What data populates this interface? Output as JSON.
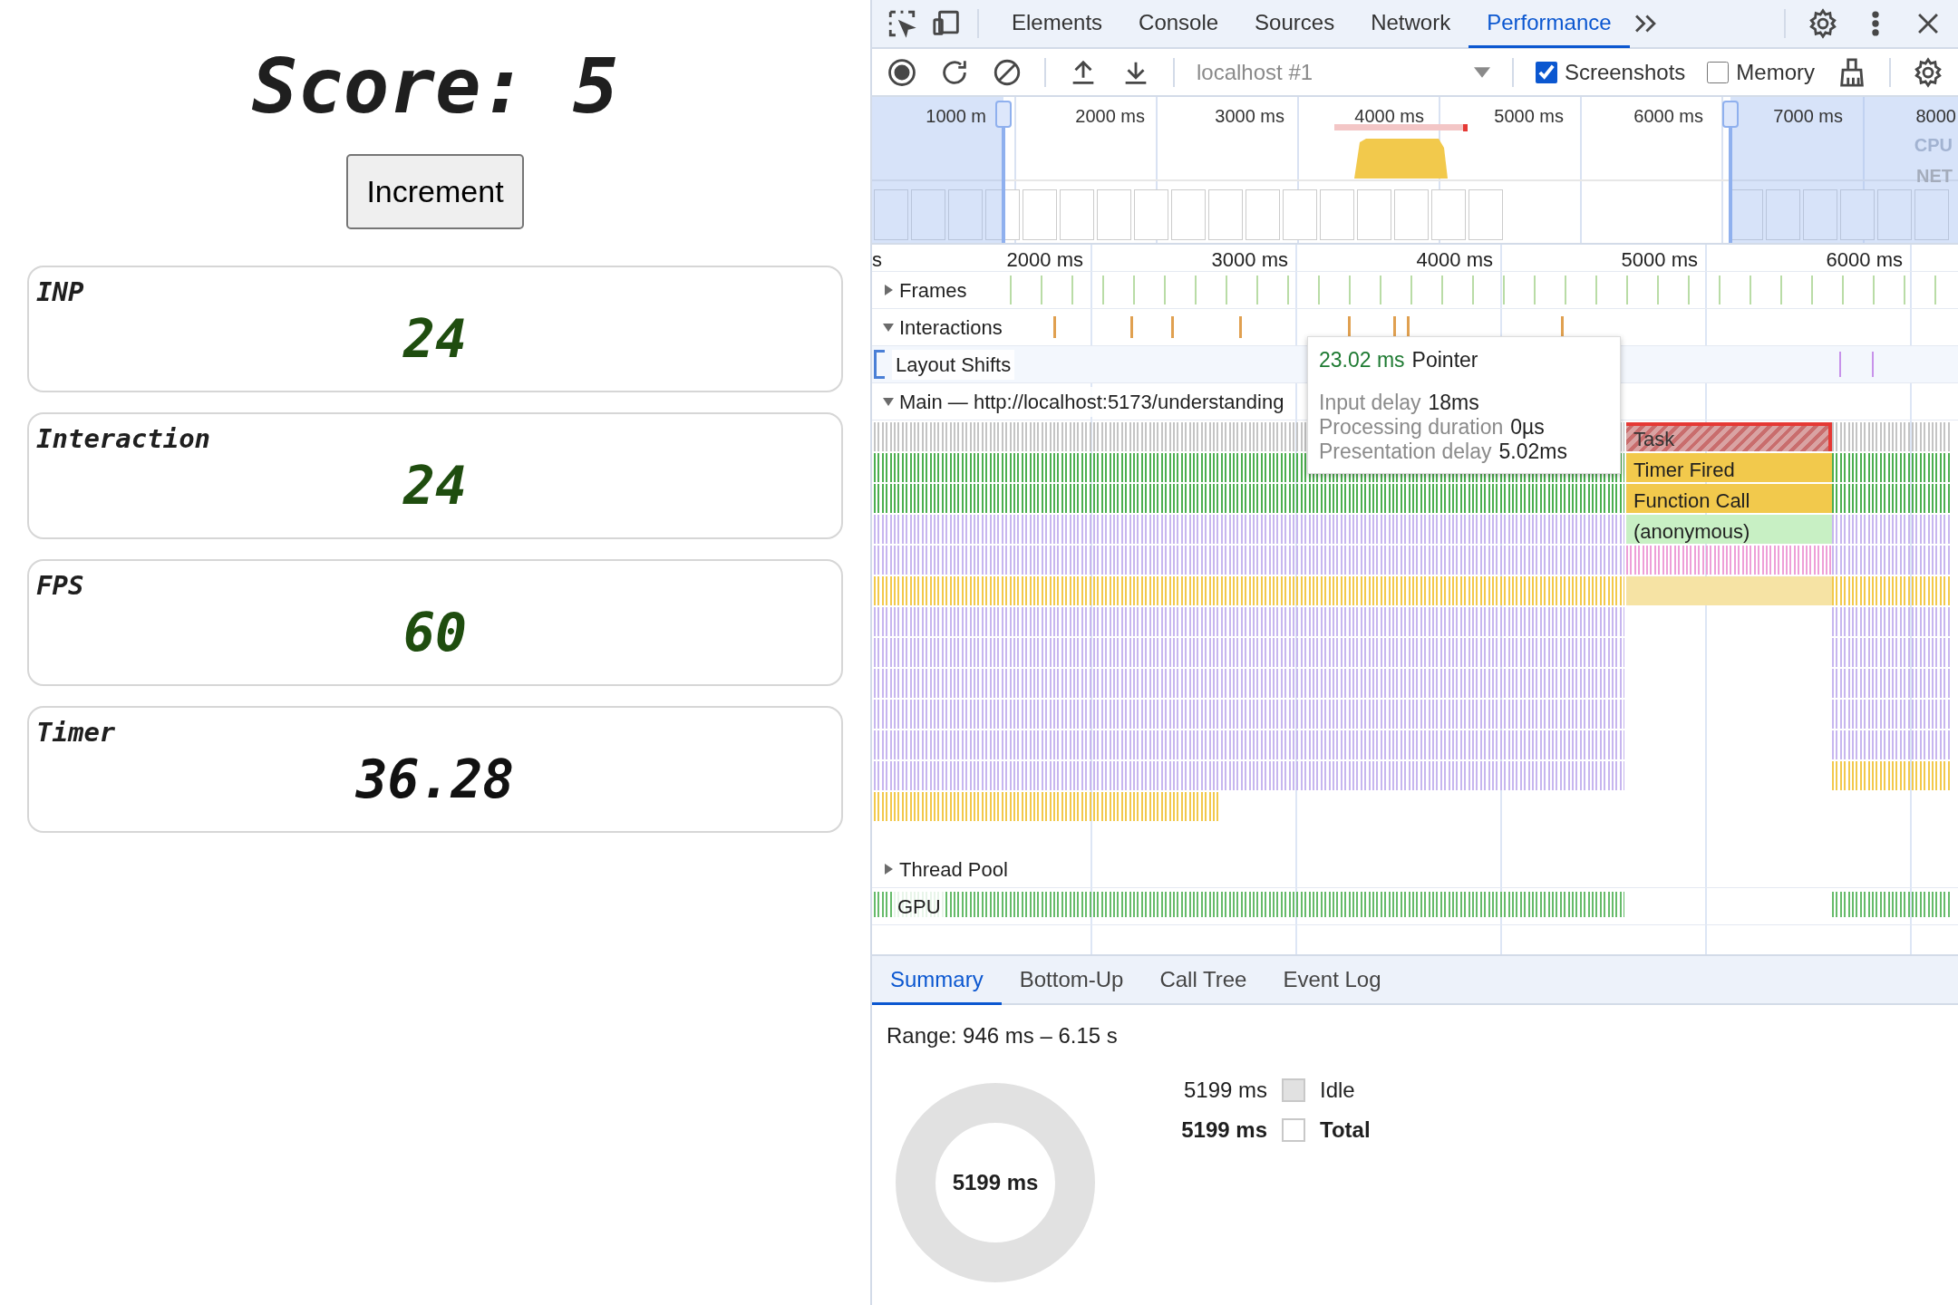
{
  "page": {
    "score_label": "Score:",
    "score": "5",
    "button": "Increment",
    "metrics": [
      {
        "label": "INP",
        "value": "24",
        "color": "#1f4d0f"
      },
      {
        "label": "Interaction",
        "value": "24",
        "color": "#1f4d0f"
      },
      {
        "label": "FPS",
        "value": "60",
        "color": "#1f4d0f"
      },
      {
        "label": "Timer",
        "value": "36.28",
        "color": "#111111"
      }
    ]
  },
  "devtools": {
    "tabs": [
      {
        "label": "Elements",
        "selected": false
      },
      {
        "label": "Console",
        "selected": false
      },
      {
        "label": "Sources",
        "selected": false
      },
      {
        "label": "Network",
        "selected": false
      },
      {
        "label": "Performance",
        "selected": true
      }
    ],
    "toolbar": {
      "target": "localhost #1",
      "options": [
        {
          "label": "Screenshots",
          "checked": true
        },
        {
          "label": "Memory",
          "checked": false
        }
      ]
    },
    "overview": {
      "ticks": [
        "1000 m",
        "2000 ms",
        "3000 ms",
        "4000 ms",
        "5000 ms",
        "6000 ms",
        "7000 ms",
        "8000"
      ],
      "cpu_label": "CPU",
      "net_label": "NET"
    },
    "ruler": [
      "s",
      "2000 ms",
      "3000 ms",
      "4000 ms",
      "5000 ms",
      "6000 ms"
    ],
    "tracks": [
      {
        "label": "Frames",
        "kind": "frames",
        "expanded": false
      },
      {
        "label": "Interactions",
        "kind": "interactions",
        "expanded": true
      },
      {
        "label": "Layout Shifts",
        "kind": "shifts"
      },
      {
        "label": "Main — http://localhost:5173/understanding",
        "kind": "main",
        "expanded": true
      },
      {
        "label": "Thread Pool",
        "kind": "group",
        "expanded": false
      },
      {
        "label": "GPU",
        "kind": "gpu"
      }
    ],
    "flame_blocks": [
      {
        "label": "Task",
        "kind": "task"
      },
      {
        "label": "Timer Fired",
        "kind": "event"
      },
      {
        "label": "Function Call",
        "kind": "event"
      },
      {
        "label": "(anonymous)",
        "kind": "script"
      }
    ],
    "tooltip": {
      "duration": "23.02 ms",
      "type": "Pointer",
      "rows": [
        {
          "label": "Input delay",
          "value": "18ms"
        },
        {
          "label": "Processing duration",
          "value": "0µs"
        },
        {
          "label": "Presentation delay",
          "value": "5.02ms"
        }
      ]
    },
    "bottom_tabs": [
      {
        "label": "Summary",
        "selected": true
      },
      {
        "label": "Bottom-Up",
        "selected": false
      },
      {
        "label": "Call Tree",
        "selected": false
      },
      {
        "label": "Event Log",
        "selected": false
      }
    ],
    "summary": {
      "range": "Range: 946 ms – 6.15 s",
      "center": "5199 ms",
      "legend": [
        {
          "value": "5199 ms",
          "label": "Idle",
          "kind": "item",
          "color": "#e1e1e1"
        },
        {
          "value": "5199 ms",
          "label": "Total",
          "kind": "total",
          "color": "#ffffff"
        }
      ]
    }
  }
}
